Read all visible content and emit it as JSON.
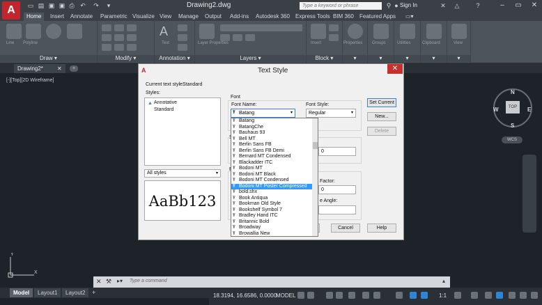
{
  "app": {
    "title": "Drawing2.dwg",
    "search_placeholder": "Type a keyword or phrase",
    "signin": "Sign In",
    "logo_letter": "A"
  },
  "ribbon_tabs": [
    "Home",
    "Insert",
    "Annotate",
    "Parametric",
    "Visualize",
    "View",
    "Manage",
    "Output",
    "Add-ins",
    "Autodesk 360",
    "Express Tools",
    "BIM 360",
    "Featured Apps"
  ],
  "ribbon_panels": {
    "draw": "Draw",
    "modify": "Modify",
    "annotation": "Annotation",
    "layers": "Layers",
    "block": "Block",
    "line": "Line",
    "polyline": "Polyline",
    "text": "Text",
    "layer_properties": "Layer Properties",
    "insert": "Insert",
    "properties": "Properties",
    "groups": "Groups",
    "utilities": "Utilities",
    "clipboard": "Clipboard",
    "view": "View"
  },
  "document_tab": "Drawing2*",
  "viewport_label": "[-][Top][2D Wireframe]",
  "viewcube": {
    "top": "TOP",
    "n": "N",
    "s": "S",
    "e": "E",
    "w": "W",
    "wcs": "WCS"
  },
  "command": {
    "placeholder": "Type a command"
  },
  "layout_tabs": [
    "Model",
    "Layout1",
    "Layout2"
  ],
  "status": {
    "coords": "18.3194, 16.6586, 0.0000",
    "model": "MODEL",
    "scale": "1:1"
  },
  "dialog": {
    "title": "Text Style",
    "current_style_label": "Current text style:",
    "current_style_value": "Standard",
    "styles_label": "Styles:",
    "styles": [
      "Annotative",
      "Standard"
    ],
    "filter": "All styles",
    "preview": "AaBb123",
    "font_group": "Font",
    "font_name_label": "Font Name:",
    "font_name_value": "Batang",
    "font_style_label": "Font Style:",
    "font_style_value": "Regular",
    "size_group": "S",
    "effects_group": "E",
    "width_factor_label": "Factor:",
    "width_factor_value": "0",
    "oblique_label": "e Angle:",
    "height_value": "0",
    "set_current": "Set Current",
    "new": "New...",
    "delete": "Delete",
    "cancel": "Cancel",
    "help": "Help",
    "apply_arrow": "▾",
    "font_list": [
      "Batang",
      "BatangChe",
      "Bauhaus 93",
      "Bell MT",
      "Berlin Sans FB",
      "Berlin Sans FB Demi",
      "Bernard MT Condensed",
      "Blackadder ITC",
      "Bodoni MT",
      "Bodoni MT Black",
      "Bodoni MT Condensed",
      "Bodoni MT Poster Compressed",
      "bold.shx",
      "Book Antiqua",
      "Bookman Old Style",
      "Bookshelf Symbol 7",
      "Bradley Hand ITC",
      "Britannic Bold",
      "Broadway",
      "Browallia New"
    ],
    "selected_font": "Bodoni MT Poster Compressed"
  },
  "colors": {
    "accent": "#3399ff",
    "brand": "#c0262c",
    "close": "#c7302f"
  }
}
